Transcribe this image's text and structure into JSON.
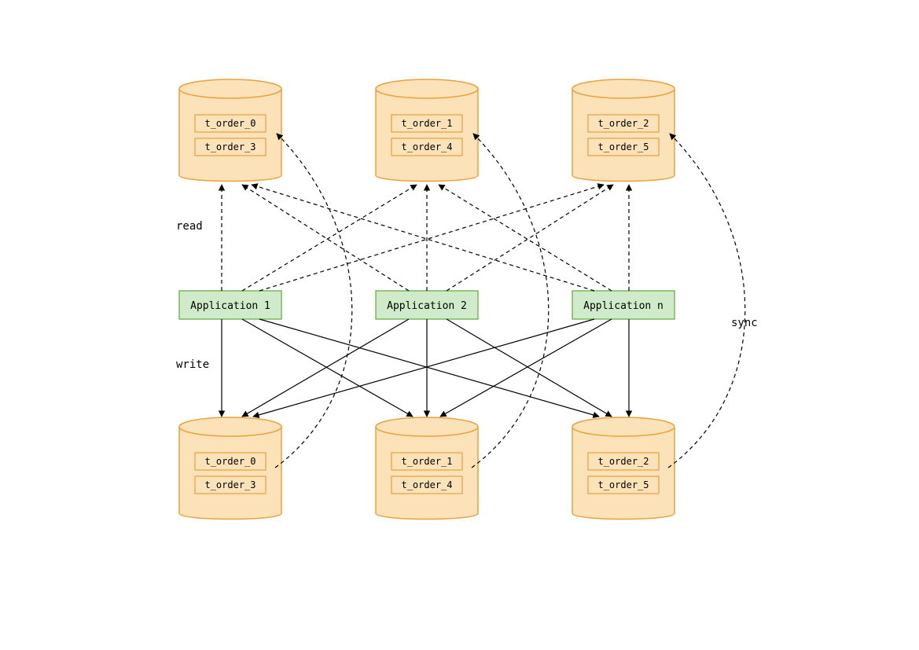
{
  "labels": {
    "read": "read",
    "write": "write",
    "sync": "sync"
  },
  "applications": [
    {
      "name": "Application 1"
    },
    {
      "name": "Application 2"
    },
    {
      "name": "Application n"
    }
  ],
  "databases_top": [
    {
      "tables": [
        "t_order_0",
        "t_order_3"
      ]
    },
    {
      "tables": [
        "t_order_1",
        "t_order_4"
      ]
    },
    {
      "tables": [
        "t_order_2",
        "t_order_5"
      ]
    }
  ],
  "databases_bottom": [
    {
      "tables": [
        "t_order_0",
        "t_order_3"
      ]
    },
    {
      "tables": [
        "t_order_1",
        "t_order_4"
      ]
    },
    {
      "tables": [
        "t_order_2",
        "t_order_5"
      ]
    }
  ],
  "colors": {
    "db_fill": "#FCE2B8",
    "db_stroke": "#E9A13B",
    "table_fill": "#FCE2B8",
    "table_stroke": "#E9A13B",
    "app_fill": "#CFEBC9",
    "app_stroke": "#7BB661",
    "line": "#000000"
  }
}
